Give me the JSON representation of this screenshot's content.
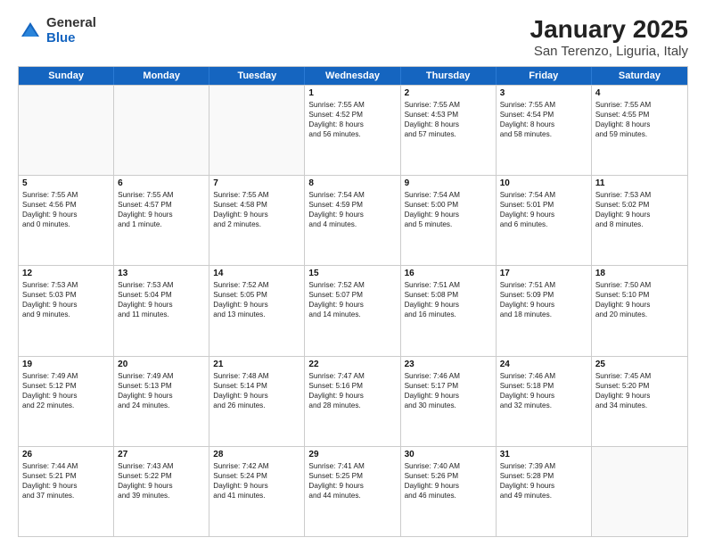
{
  "logo": {
    "general": "General",
    "blue": "Blue"
  },
  "title": "January 2025",
  "subtitle": "San Terenzo, Liguria, Italy",
  "days": [
    "Sunday",
    "Monday",
    "Tuesday",
    "Wednesday",
    "Thursday",
    "Friday",
    "Saturday"
  ],
  "weeks": [
    [
      {
        "day": "",
        "text": ""
      },
      {
        "day": "",
        "text": ""
      },
      {
        "day": "",
        "text": ""
      },
      {
        "day": "1",
        "text": "Sunrise: 7:55 AM\nSunset: 4:52 PM\nDaylight: 8 hours\nand 56 minutes."
      },
      {
        "day": "2",
        "text": "Sunrise: 7:55 AM\nSunset: 4:53 PM\nDaylight: 8 hours\nand 57 minutes."
      },
      {
        "day": "3",
        "text": "Sunrise: 7:55 AM\nSunset: 4:54 PM\nDaylight: 8 hours\nand 58 minutes."
      },
      {
        "day": "4",
        "text": "Sunrise: 7:55 AM\nSunset: 4:55 PM\nDaylight: 8 hours\nand 59 minutes."
      }
    ],
    [
      {
        "day": "5",
        "text": "Sunrise: 7:55 AM\nSunset: 4:56 PM\nDaylight: 9 hours\nand 0 minutes."
      },
      {
        "day": "6",
        "text": "Sunrise: 7:55 AM\nSunset: 4:57 PM\nDaylight: 9 hours\nand 1 minute."
      },
      {
        "day": "7",
        "text": "Sunrise: 7:55 AM\nSunset: 4:58 PM\nDaylight: 9 hours\nand 2 minutes."
      },
      {
        "day": "8",
        "text": "Sunrise: 7:54 AM\nSunset: 4:59 PM\nDaylight: 9 hours\nand 4 minutes."
      },
      {
        "day": "9",
        "text": "Sunrise: 7:54 AM\nSunset: 5:00 PM\nDaylight: 9 hours\nand 5 minutes."
      },
      {
        "day": "10",
        "text": "Sunrise: 7:54 AM\nSunset: 5:01 PM\nDaylight: 9 hours\nand 6 minutes."
      },
      {
        "day": "11",
        "text": "Sunrise: 7:53 AM\nSunset: 5:02 PM\nDaylight: 9 hours\nand 8 minutes."
      }
    ],
    [
      {
        "day": "12",
        "text": "Sunrise: 7:53 AM\nSunset: 5:03 PM\nDaylight: 9 hours\nand 9 minutes."
      },
      {
        "day": "13",
        "text": "Sunrise: 7:53 AM\nSunset: 5:04 PM\nDaylight: 9 hours\nand 11 minutes."
      },
      {
        "day": "14",
        "text": "Sunrise: 7:52 AM\nSunset: 5:05 PM\nDaylight: 9 hours\nand 13 minutes."
      },
      {
        "day": "15",
        "text": "Sunrise: 7:52 AM\nSunset: 5:07 PM\nDaylight: 9 hours\nand 14 minutes."
      },
      {
        "day": "16",
        "text": "Sunrise: 7:51 AM\nSunset: 5:08 PM\nDaylight: 9 hours\nand 16 minutes."
      },
      {
        "day": "17",
        "text": "Sunrise: 7:51 AM\nSunset: 5:09 PM\nDaylight: 9 hours\nand 18 minutes."
      },
      {
        "day": "18",
        "text": "Sunrise: 7:50 AM\nSunset: 5:10 PM\nDaylight: 9 hours\nand 20 minutes."
      }
    ],
    [
      {
        "day": "19",
        "text": "Sunrise: 7:49 AM\nSunset: 5:12 PM\nDaylight: 9 hours\nand 22 minutes."
      },
      {
        "day": "20",
        "text": "Sunrise: 7:49 AM\nSunset: 5:13 PM\nDaylight: 9 hours\nand 24 minutes."
      },
      {
        "day": "21",
        "text": "Sunrise: 7:48 AM\nSunset: 5:14 PM\nDaylight: 9 hours\nand 26 minutes."
      },
      {
        "day": "22",
        "text": "Sunrise: 7:47 AM\nSunset: 5:16 PM\nDaylight: 9 hours\nand 28 minutes."
      },
      {
        "day": "23",
        "text": "Sunrise: 7:46 AM\nSunset: 5:17 PM\nDaylight: 9 hours\nand 30 minutes."
      },
      {
        "day": "24",
        "text": "Sunrise: 7:46 AM\nSunset: 5:18 PM\nDaylight: 9 hours\nand 32 minutes."
      },
      {
        "day": "25",
        "text": "Sunrise: 7:45 AM\nSunset: 5:20 PM\nDaylight: 9 hours\nand 34 minutes."
      }
    ],
    [
      {
        "day": "26",
        "text": "Sunrise: 7:44 AM\nSunset: 5:21 PM\nDaylight: 9 hours\nand 37 minutes."
      },
      {
        "day": "27",
        "text": "Sunrise: 7:43 AM\nSunset: 5:22 PM\nDaylight: 9 hours\nand 39 minutes."
      },
      {
        "day": "28",
        "text": "Sunrise: 7:42 AM\nSunset: 5:24 PM\nDaylight: 9 hours\nand 41 minutes."
      },
      {
        "day": "29",
        "text": "Sunrise: 7:41 AM\nSunset: 5:25 PM\nDaylight: 9 hours\nand 44 minutes."
      },
      {
        "day": "30",
        "text": "Sunrise: 7:40 AM\nSunset: 5:26 PM\nDaylight: 9 hours\nand 46 minutes."
      },
      {
        "day": "31",
        "text": "Sunrise: 7:39 AM\nSunset: 5:28 PM\nDaylight: 9 hours\nand 49 minutes."
      },
      {
        "day": "",
        "text": ""
      }
    ]
  ]
}
